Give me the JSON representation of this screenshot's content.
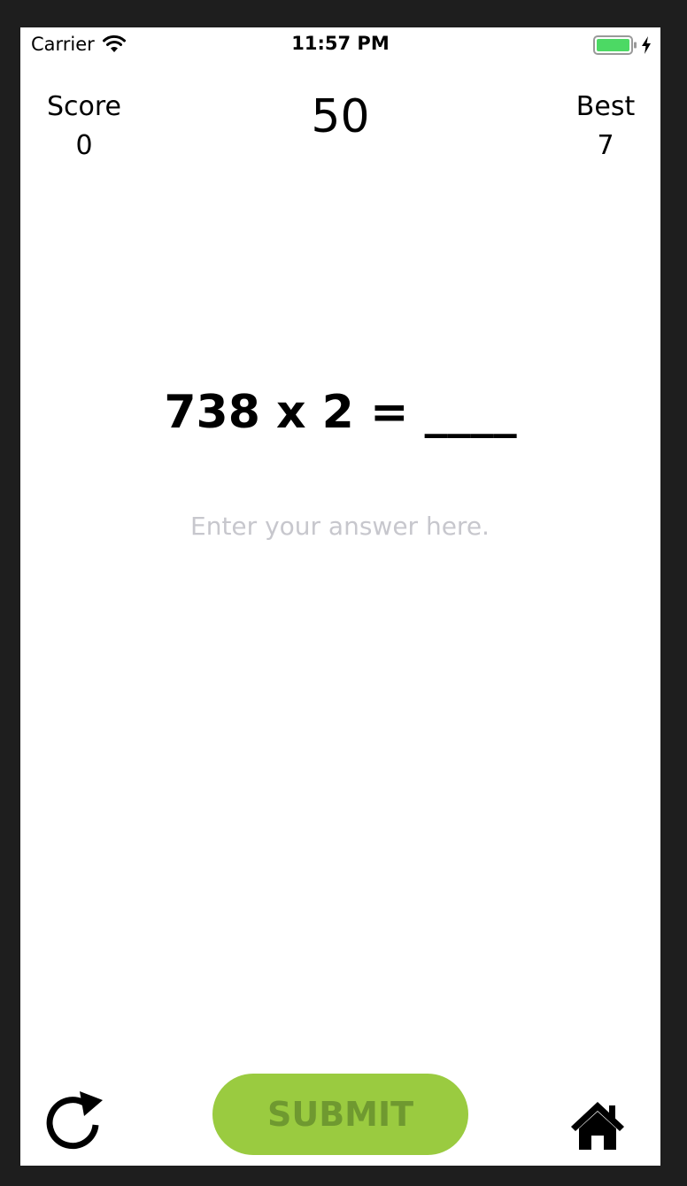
{
  "status_bar": {
    "carrier": "Carrier",
    "time": "11:57 PM",
    "wifi_icon": "wifi-icon",
    "battery_icon": "battery-icon",
    "charging_icon": "charging-icon",
    "battery_color": "#4cd964"
  },
  "header": {
    "score_label": "Score",
    "score_value": "0",
    "timer_value": "50",
    "best_label": "Best",
    "best_value": "7"
  },
  "problem": {
    "text": "738 x 2 = ____"
  },
  "answer": {
    "value": "",
    "placeholder": "Enter your answer here."
  },
  "controls": {
    "restart_icon": "restart-icon",
    "submit_label": "SUBMIT",
    "home_icon": "home-icon",
    "submit_color": "#9acb40",
    "submit_text_color": "#6f9930"
  }
}
